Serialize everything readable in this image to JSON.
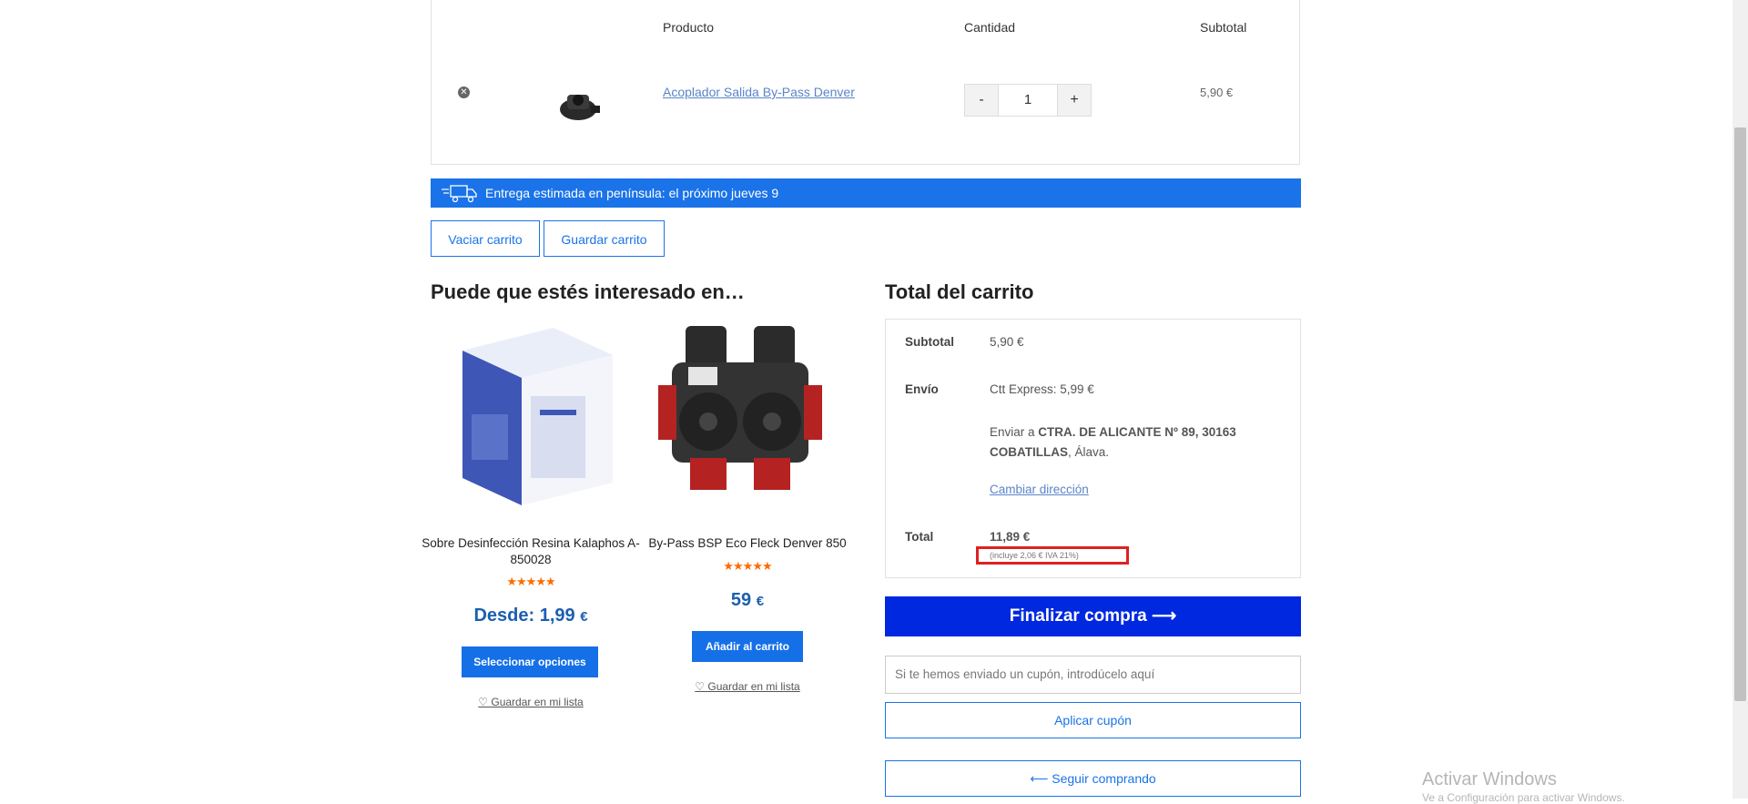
{
  "cart": {
    "headers": {
      "product": "Producto",
      "quantity": "Cantidad",
      "subtotal": "Subtotal"
    },
    "items": [
      {
        "name": "Acoplador Salida By-Pass Denver",
        "quantity": "1",
        "subtotal": "5,90 €",
        "minus": "-",
        "plus": "+"
      }
    ]
  },
  "delivery": {
    "text": "Entrega estimada en península: el próximo jueves 9",
    "icon": "truck-icon"
  },
  "actions": {
    "empty": "Vaciar carrito",
    "save": "Guardar carrito"
  },
  "recommendations": {
    "title": "Puede que estés interesado en…",
    "items": [
      {
        "name": "Sobre Desinfección Resina Kalaphos A-850028",
        "stars": "★★★★★",
        "price_prefix": "Desde: ",
        "price": "1,99",
        "currency": "€",
        "button": "Seleccionar opciones",
        "wishlist": "Guardar en mi lista"
      },
      {
        "name": "By-Pass BSP Eco Fleck Denver 850",
        "stars": "★★★★★",
        "price_prefix": "",
        "price": "59",
        "currency": "€",
        "button": "Añadir al carrito",
        "wishlist": "Guardar en mi lista"
      }
    ]
  },
  "totals": {
    "title": "Total del carrito",
    "subtotal_label": "Subtotal",
    "subtotal_value": "5,90 €",
    "shipping_label": "Envío",
    "shipping_method": "Ctt Express: 5,99 €",
    "ship_to_prefix": "Enviar a ",
    "ship_to_address_line1": "CTRA. DE ALICANTE Nº 89, 30163",
    "ship_to_address_line2": "COBATILLAS",
    "ship_to_region": ", Álava.",
    "change_address": "Cambiar dirección",
    "total_label": "Total",
    "total_value": "11,89 €",
    "tax_note": "(incluye 2,06 € IVA 21%)"
  },
  "checkout": {
    "label": "Finalizar compra",
    "arrow": "⟶"
  },
  "coupon": {
    "placeholder": "Si te hemos enviado un cupón, introdúcelo aquí",
    "apply": "Aplicar cupón"
  },
  "continue": {
    "label": "⟵ Seguir comprando"
  },
  "windows": {
    "title": "Activar Windows",
    "subtitle": "Ve a Configuración para activar Windows."
  },
  "colors": {
    "accent": "#1a73e8",
    "checkout": "#0028e0",
    "highlight": "#e02020",
    "stars": "#ff6a00"
  }
}
